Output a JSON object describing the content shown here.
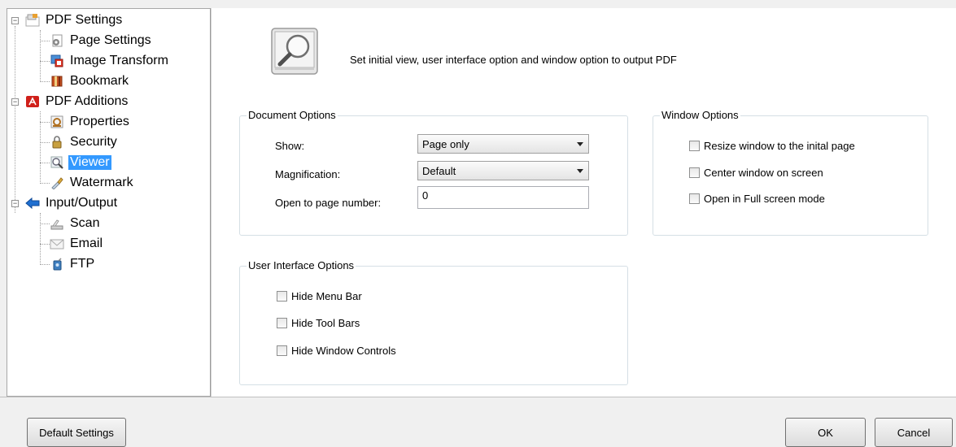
{
  "tree": {
    "pdf_settings": "PDF Settings",
    "page_settings": "Page Settings",
    "image_transform": "Image Transform",
    "bookmark": "Bookmark",
    "pdf_additions": "PDF Additions",
    "properties": "Properties",
    "security": "Security",
    "viewer": "Viewer",
    "watermark": "Watermark",
    "input_output": "Input/Output",
    "scan": "Scan",
    "email": "Email",
    "ftp": "FTP",
    "expander_symbol": "−"
  },
  "header": {
    "icon": "magnifier-icon",
    "description": "Set initial view, user interface option and window option to output PDF"
  },
  "document_options": {
    "title": "Document Options",
    "show_label": "Show:",
    "show_value": "Page only",
    "magnification_label": "Magnification:",
    "magnification_value": "Default",
    "open_page_label": "Open to page number:",
    "open_page_value": "0"
  },
  "window_options": {
    "title": "Window Options",
    "resize": "Resize window to the inital page",
    "center": "Center window on screen",
    "fullscreen": "Open in Full screen mode"
  },
  "ui_options": {
    "title": "User Interface Options",
    "hide_menu": "Hide Menu Bar",
    "hide_tool": "Hide Tool Bars",
    "hide_window": "Hide Window Controls"
  },
  "buttons": {
    "default_settings": "Default Settings",
    "ok": "OK",
    "cancel": "Cancel"
  },
  "colors": {
    "selection": "#3399ff",
    "tree_expand_arrow": "#1f6fd0"
  }
}
